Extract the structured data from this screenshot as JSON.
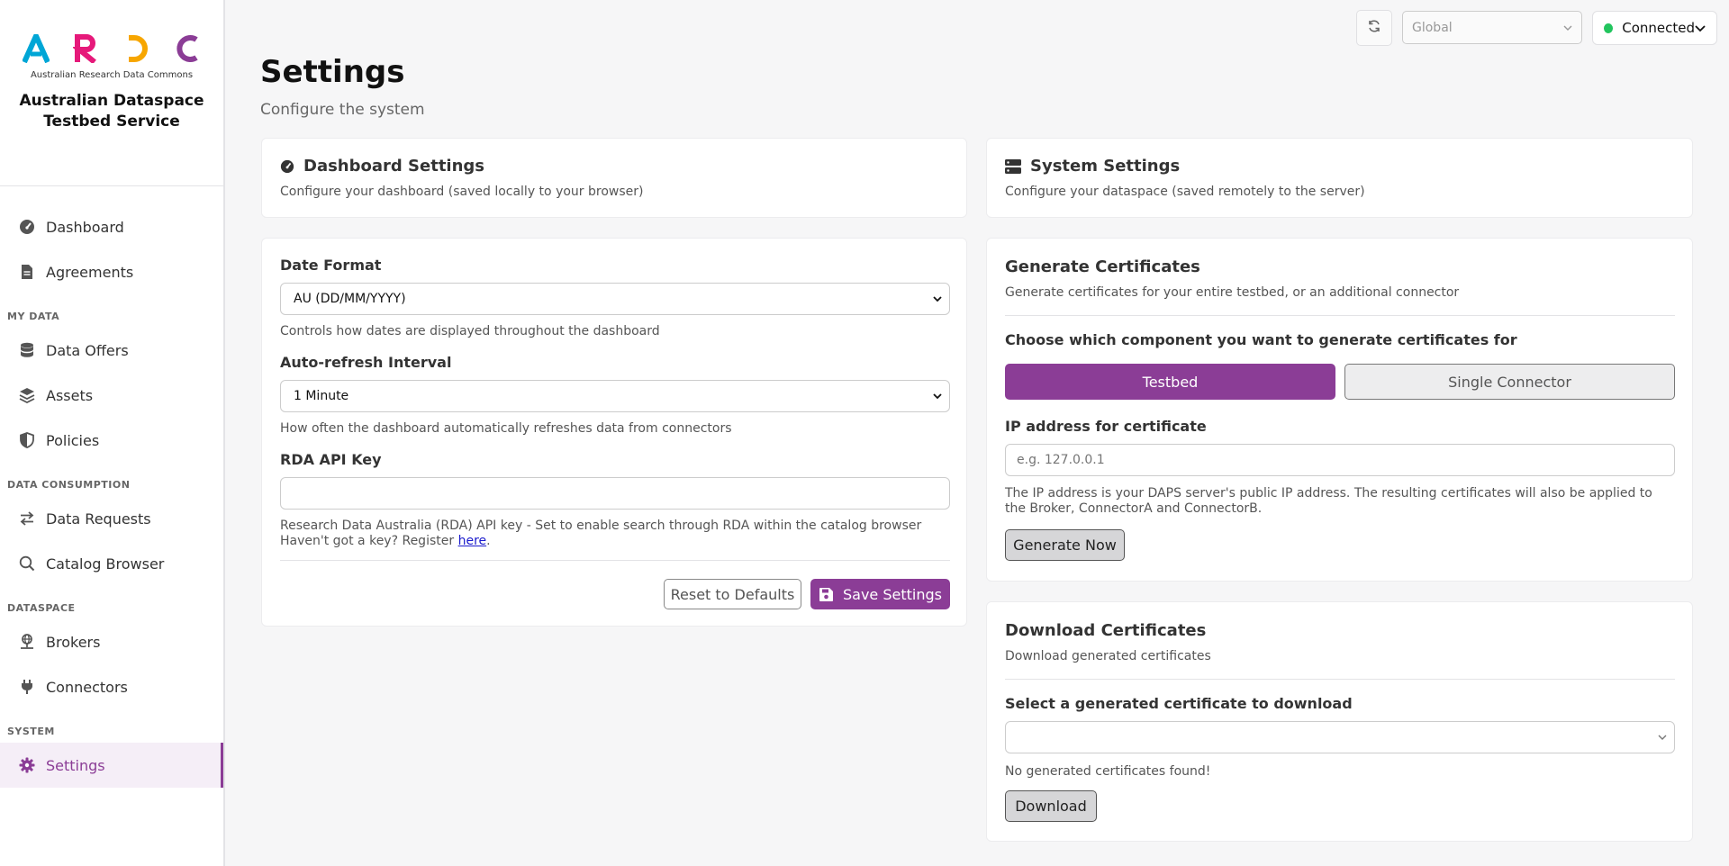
{
  "brand": {
    "logo_letters": [
      "A",
      "R",
      "D",
      "C"
    ],
    "logo_subtitle": "Australian Research Data Commons",
    "title_line1": "Australian Dataspace",
    "title_line2": "Testbed Service",
    "colors": {
      "a": "#00a6d6",
      "r": "#e6197a",
      "d": "#f7a600",
      "c": "#8b3d96"
    }
  },
  "sidebar": {
    "items_top": [
      {
        "label": "Dashboard",
        "icon": "gauge-icon"
      },
      {
        "label": "Agreements",
        "icon": "document-icon"
      }
    ],
    "section_my_data": "MY DATA",
    "items_my_data": [
      {
        "label": "Data Offers",
        "icon": "database-icon"
      },
      {
        "label": "Assets",
        "icon": "layers-icon"
      },
      {
        "label": "Policies",
        "icon": "shield-icon"
      }
    ],
    "section_consumption": "DATA CONSUMPTION",
    "items_consumption": [
      {
        "label": "Data Requests",
        "icon": "arrows-icon"
      },
      {
        "label": "Catalog Browser",
        "icon": "search-icon"
      }
    ],
    "section_dataspace": "DATASPACE",
    "items_dataspace": [
      {
        "label": "Brokers",
        "icon": "network-icon"
      },
      {
        "label": "Connectors",
        "icon": "plug-icon"
      }
    ],
    "section_system": "SYSTEM",
    "items_system": [
      {
        "label": "Settings",
        "icon": "gear-icon",
        "active": true
      }
    ]
  },
  "topbar": {
    "scope_value": "Global",
    "status_label": "Connected",
    "status_color": "#22c55e"
  },
  "page": {
    "title": "Settings",
    "subtitle": "Configure the system"
  },
  "dashboard_settings": {
    "title": "Dashboard Settings",
    "description": "Configure your dashboard (saved locally to your browser)",
    "date_format_label": "Date Format",
    "date_format_value": "AU (DD/MM/YYYY)",
    "date_format_help": "Controls how dates are displayed throughout the dashboard",
    "refresh_label": "Auto-refresh Interval",
    "refresh_value": "1 Minute",
    "refresh_help": "How often the dashboard automatically refreshes data from connectors",
    "rda_label": "RDA API Key",
    "rda_value": "",
    "rda_help_line1": "Research Data Australia (RDA) API key - Set to enable search through RDA within the catalog browser",
    "rda_help_line2_prefix": "Haven't got a key? Register ",
    "rda_help_link": "here",
    "rda_help_suffix": ".",
    "reset_button": "Reset to Defaults",
    "save_button": "Save Settings"
  },
  "system_settings": {
    "title": "System Settings",
    "description": "Configure your dataspace (saved remotely to the server)"
  },
  "generate_certs": {
    "title": "Generate Certificates",
    "description": "Generate certificates for your entire testbed, or an additional connector",
    "choose_label": "Choose which component you want to generate certificates for",
    "option_testbed": "Testbed",
    "option_single": "Single Connector",
    "ip_label": "IP address for certificate",
    "ip_placeholder": "e.g. 127.0.0.1",
    "ip_help": "The IP address is your DAPS server's public IP address. The resulting certificates will also be applied to the Broker, ConnectorA and ConnectorB.",
    "generate_button": "Generate Now"
  },
  "download_certs": {
    "title": "Download Certificates",
    "description": "Download generated certificates",
    "select_label": "Select a generated certificate to download",
    "select_value": "",
    "empty_message": "No generated certificates found!",
    "download_button": "Download"
  }
}
